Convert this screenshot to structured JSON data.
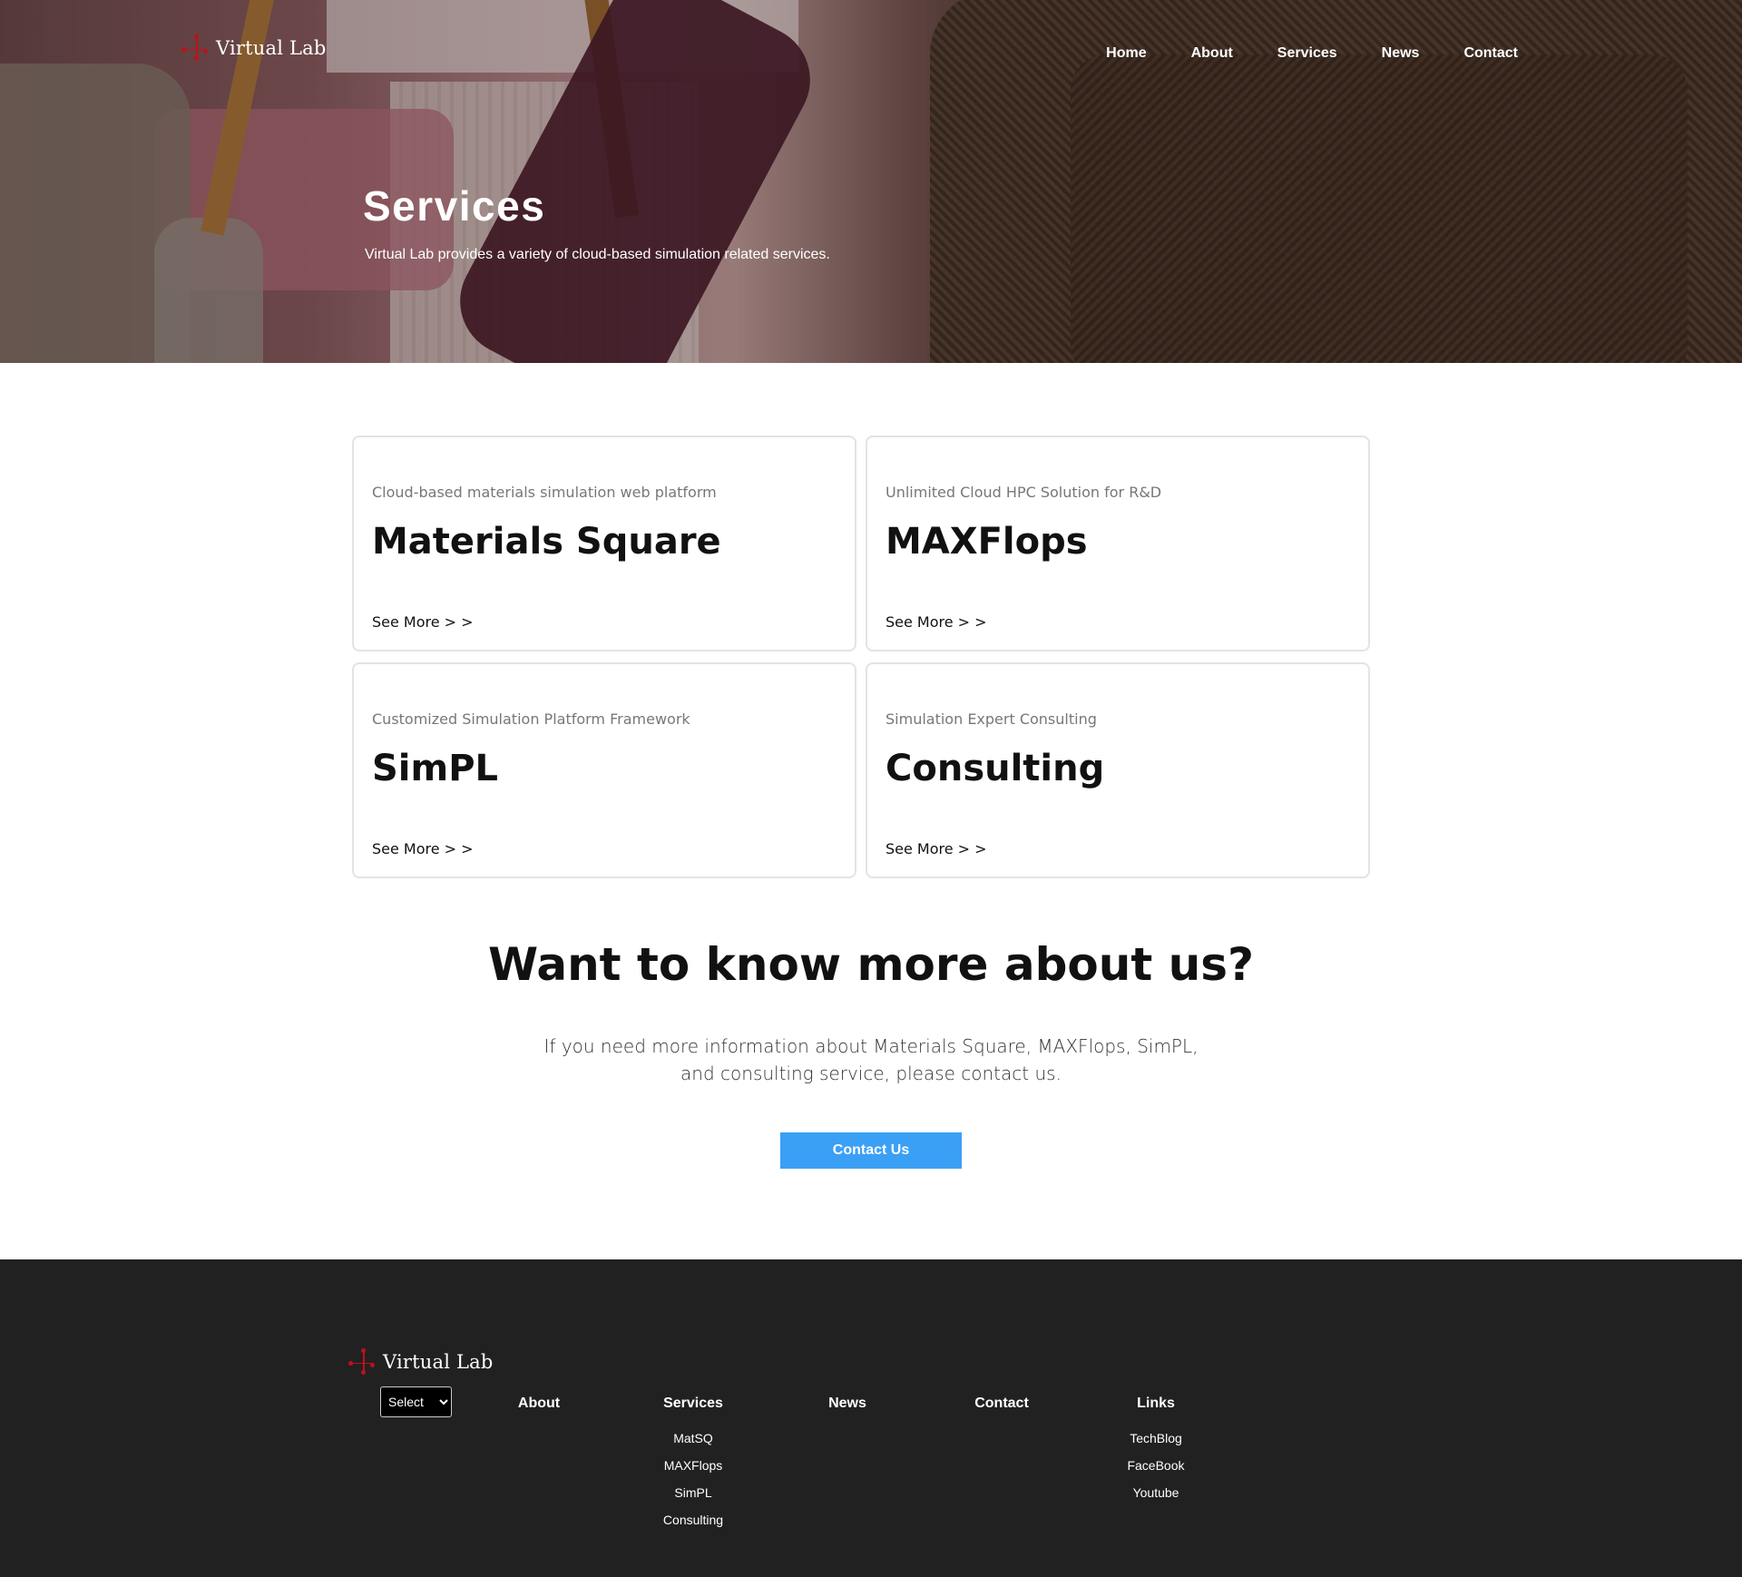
{
  "brand": {
    "name": "Virtual Lab",
    "accent": "#c0101a"
  },
  "nav": [
    "Home",
    "About",
    "Services",
    "News",
    "Contact"
  ],
  "hero": {
    "title": "Services",
    "subtitle": "Virtual Lab provides a variety of cloud-based simulation related services."
  },
  "services": [
    {
      "kicker": "Cloud-based materials simulation web platform",
      "title": "Materials Square",
      "more": "See More > >"
    },
    {
      "kicker": "Unlimited Cloud HPC Solution for R&D",
      "title": "MAXFlops",
      "more": "See More > >"
    },
    {
      "kicker": "Customized Simulation Platform Framework",
      "title": "SimPL",
      "more": "See More > >"
    },
    {
      "kicker": "Simulation Expert Consulting",
      "title": "Consulting",
      "more": "See More > >"
    }
  ],
  "cta": {
    "title": "Want to know more about us?",
    "line1": "If you need more information about Materials Square, MAXFlops, SimPL,",
    "line2": "and consulting service, please contact us.",
    "button": "Contact Us",
    "button_color": "#3aa0f5"
  },
  "footer": {
    "background": "#212121",
    "select_value": "Select",
    "columns": {
      "about": {
        "heading": "About"
      },
      "services": {
        "heading": "Services",
        "links": [
          "MatSQ",
          "MAXFlops",
          "SimPL",
          "Consulting"
        ]
      },
      "news": {
        "heading": "News"
      },
      "contact": {
        "heading": "Contact"
      },
      "links": {
        "heading": "Links",
        "links": [
          "TechBlog",
          "FaceBook",
          "Youtube"
        ]
      }
    }
  }
}
